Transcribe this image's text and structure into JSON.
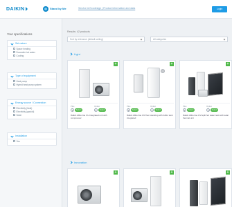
{
  "header": {
    "logo_text": "DAIKIN",
    "brand_sub": "Stand by Me",
    "top_link": "Service & Ecodesign | Product information and data",
    "button_label": "Login"
  },
  "sidebar": {
    "title": "Your specifications",
    "filters": [
      {
        "label": "Set nature",
        "options": [
          "Space heating",
          "Domestic hot water",
          "Cooling"
        ]
      },
      {
        "label": "Type of equipment",
        "options": [
          "Heat pump",
          "Hybrid heat pump system"
        ]
      },
      {
        "label": "Energy source / Connection",
        "options": [
          "Electricity (heat)",
          "Electricity (gas/oil)",
          "Solar"
        ]
      },
      {
        "label": "Installation",
        "options": [
          "Yes"
        ]
      }
    ]
  },
  "main": {
    "select_label": "Results: 42 products",
    "select_left": "Sort by relevance (default sorting)",
    "select_right": "All categories",
    "sections": [
      {
        "title": "Light",
        "cards": [
          {
            "name": "Daikin Altherma 3 H integrated unit with compressor",
            "opt1": "Plus",
            "opt2": "Option",
            "badge1": "Select",
            "badge2": "Select",
            "num": "1"
          },
          {
            "name": "Daikin Altherma 3 R floor standing with buffer tank integrated",
            "opt1": "Plus",
            "opt2": "Option",
            "badge1": "Select",
            "badge2": "Select",
            "num": "1"
          },
          {
            "name": "Daikin Altherma 3 M split hot water tank with solar thermal unit",
            "opt1": "Plus",
            "opt2": "Option",
            "badge1": "Select",
            "badge2": "Select",
            "num": "1"
          }
        ]
      },
      {
        "title": "Innovation",
        "cards": [
          {
            "name": "",
            "opt1": "",
            "opt2": "",
            "badge1": "",
            "badge2": "",
            "num": ""
          },
          {
            "name": "",
            "opt1": "",
            "opt2": "",
            "badge1": "",
            "badge2": "",
            "num": ""
          },
          {
            "name": "",
            "opt1": "",
            "opt2": "",
            "badge1": "",
            "badge2": "",
            "num": ""
          }
        ]
      }
    ]
  },
  "colors": {
    "accent": "#1e9ce6",
    "brand": "#0a87c9",
    "success": "#4fb849",
    "background": "#eef1f4"
  }
}
